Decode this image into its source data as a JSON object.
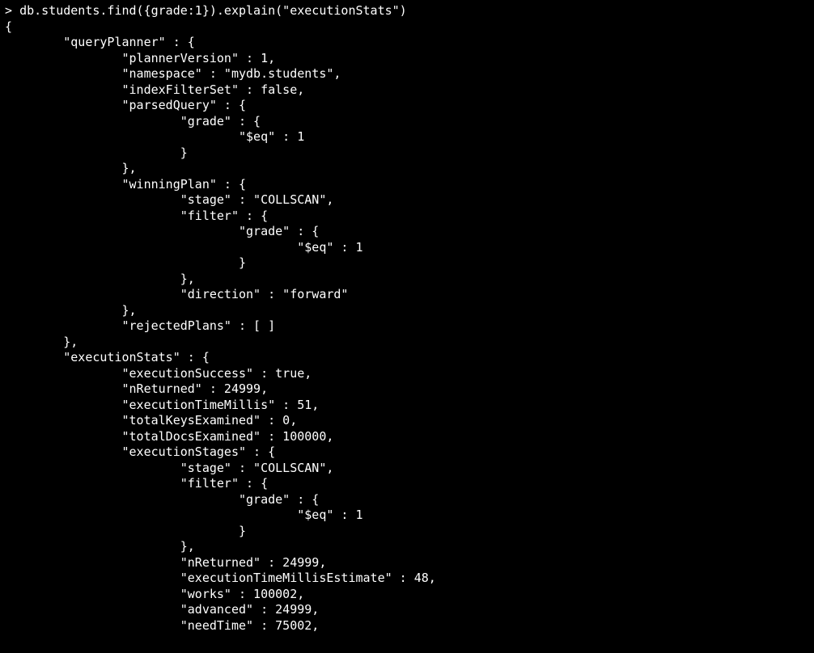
{
  "prompt": "> ",
  "command": "db.students.find({grade:1}).explain(\"executionStats\")",
  "lines": [
    "{",
    "        \"queryPlanner\" : {",
    "                \"plannerVersion\" : 1,",
    "                \"namespace\" : \"mydb.students\",",
    "                \"indexFilterSet\" : false,",
    "                \"parsedQuery\" : {",
    "                        \"grade\" : {",
    "                                \"$eq\" : 1",
    "                        }",
    "                },",
    "                \"winningPlan\" : {",
    "                        \"stage\" : \"COLLSCAN\",",
    "                        \"filter\" : {",
    "                                \"grade\" : {",
    "                                        \"$eq\" : 1",
    "                                }",
    "                        },",
    "                        \"direction\" : \"forward\"",
    "                },",
    "                \"rejectedPlans\" : [ ]",
    "        },",
    "        \"executionStats\" : {",
    "                \"executionSuccess\" : true,",
    "                \"nReturned\" : 24999,",
    "                \"executionTimeMillis\" : 51,",
    "                \"totalKeysExamined\" : 0,",
    "                \"totalDocsExamined\" : 100000,",
    "                \"executionStages\" : {",
    "                        \"stage\" : \"COLLSCAN\",",
    "                        \"filter\" : {",
    "                                \"grade\" : {",
    "                                        \"$eq\" : 1",
    "                                }",
    "                        },",
    "                        \"nReturned\" : 24999,",
    "                        \"executionTimeMillisEstimate\" : 48,",
    "                        \"works\" : 100002,",
    "                        \"advanced\" : 24999,",
    "                        \"needTime\" : 75002,"
  ]
}
